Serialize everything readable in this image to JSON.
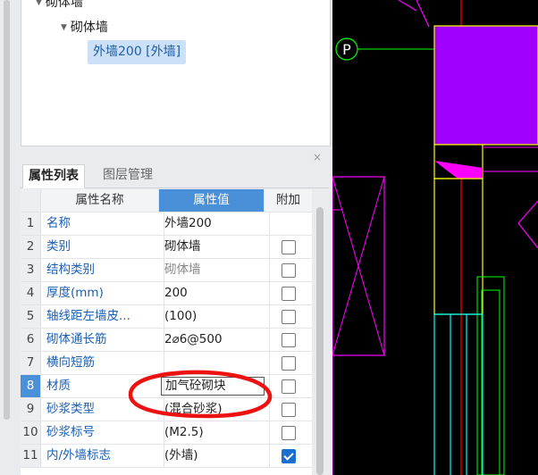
{
  "tree": {
    "partial_top_label": "砌体墙",
    "group_label": "砌体墙",
    "selected_item": "外墙200 [外墙]"
  },
  "tabs": {
    "properties": "属性列表",
    "layers": "图层管理"
  },
  "close_glyph": "×",
  "table": {
    "columns": [
      "属性名称",
      "属性值",
      "附加"
    ],
    "rows": [
      {
        "num": "1",
        "name": "名称",
        "value": "外墙200",
        "has_checkbox": false,
        "checked": false
      },
      {
        "num": "2",
        "name": "类别",
        "value": "砌体墙",
        "has_checkbox": true,
        "checked": false
      },
      {
        "num": "3",
        "name": "结构类别",
        "value": "砌体墙",
        "has_checkbox": true,
        "checked": false
      },
      {
        "num": "4",
        "name": "厚度(mm)",
        "value": "200",
        "has_checkbox": true,
        "checked": false
      },
      {
        "num": "5",
        "name": "轴线距左墙皮...",
        "value": "(100)",
        "has_checkbox": true,
        "checked": false
      },
      {
        "num": "6",
        "name": "砌体通长筋",
        "value": "2⌀6@500",
        "has_checkbox": true,
        "checked": false
      },
      {
        "num": "7",
        "name": "横向短筋",
        "value": "",
        "has_checkbox": true,
        "checked": false
      },
      {
        "num": "8",
        "name": "材质",
        "value": "加气砼砌块",
        "has_checkbox": true,
        "checked": false
      },
      {
        "num": "9",
        "name": "砂浆类型",
        "value": "(混合砂浆)",
        "has_checkbox": true,
        "checked": false
      },
      {
        "num": "10",
        "name": "砂浆标号",
        "value": "(M2.5)",
        "has_checkbox": true,
        "checked": false
      },
      {
        "num": "11",
        "name": "内/外墙标志",
        "value": "(外墙)",
        "has_checkbox": true,
        "checked": true
      }
    ]
  },
  "cad": {
    "axis_label": "P",
    "colors": {
      "background": "#000000",
      "magenta": "#ff00ff",
      "purple_fill": "#a000ff",
      "yellow": "#ffff00",
      "red": "#ff0000",
      "cyan": "#00ffff",
      "green": "#00ff00"
    }
  },
  "annotation_color": "#ee1111"
}
